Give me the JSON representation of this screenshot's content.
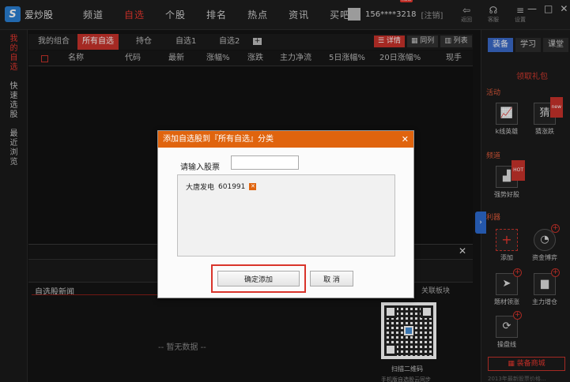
{
  "app": {
    "name": "爱炒股",
    "logo_glyph": "S"
  },
  "nav": [
    {
      "label": "频道",
      "active": false
    },
    {
      "label": "自选",
      "active": true
    },
    {
      "label": "个股",
      "active": false
    },
    {
      "label": "排名",
      "active": false
    },
    {
      "label": "热点",
      "active": false
    },
    {
      "label": "资讯",
      "active": false
    },
    {
      "label": "买吧",
      "active": false
    }
  ],
  "user": {
    "phone": "156****3218",
    "badge": "new",
    "logout": "[注销]"
  },
  "top_actions": [
    {
      "icon": "back-icon",
      "glyph": "⇦",
      "label": "返回"
    },
    {
      "icon": "service-icon",
      "glyph": "☊",
      "label": "客服"
    },
    {
      "icon": "settings-icon",
      "glyph": "≡",
      "label": "设置"
    }
  ],
  "window_controls": {
    "minimize": "—",
    "maximize": "□",
    "close": "✕"
  },
  "left_sidebar": [
    {
      "chars": [
        "我",
        "的",
        "自",
        "选"
      ],
      "active": true
    },
    {
      "chars": [
        "快",
        "速",
        "选",
        "股"
      ],
      "active": false
    },
    {
      "chars": [
        "最",
        "近",
        "浏",
        "览"
      ],
      "active": false
    }
  ],
  "tabs": [
    "我的组合",
    "所有自选",
    "持仓",
    "自选1",
    "自选2"
  ],
  "tab_add": "+",
  "view_buttons": [
    {
      "label": "☰ 详情",
      "active": true
    },
    {
      "label": "▦ 同列",
      "active": false
    },
    {
      "label": "▥ 列表",
      "active": false
    }
  ],
  "columns": [
    "名称",
    "代码",
    "最新",
    "涨幅%",
    "涨跌",
    "主力净流",
    "5日涨幅%",
    "20日涨幅%",
    "现手"
  ],
  "news": {
    "title": "自选股新闻",
    "related_tab": "关联板块",
    "empty_text": "-- 暂无数据 --"
  },
  "qr": {
    "caption": "扫描二维码",
    "caption2": "手机版自选股云同步"
  },
  "right_panel": {
    "tabs": [
      "装备",
      "学习",
      "课堂"
    ],
    "gift": "领取礼包",
    "sections": {
      "activity": "活动",
      "channel": "频道",
      "tools": "利器"
    },
    "activity_tools": [
      {
        "icon": "kline-chart-icon",
        "glyph": "📈",
        "label": "k线英雄"
      },
      {
        "icon": "guess-icon",
        "glyph": "猜",
        "label": "猜涨跌",
        "tag": "new"
      }
    ],
    "channel_tools": [
      {
        "icon": "bar-chart-icon",
        "glyph": "▟",
        "label": "强势好股",
        "tag": "HOT"
      }
    ],
    "tool_items": [
      {
        "icon": "add-icon",
        "glyph": "+",
        "label": "添加"
      },
      {
        "icon": "capital-icon",
        "glyph": "◔",
        "label": "资金博弈"
      },
      {
        "icon": "arrow-icon",
        "glyph": "➤",
        "label": "题材领涨"
      },
      {
        "icon": "histogram-icon",
        "glyph": "▆",
        "label": "主力增仓"
      },
      {
        "icon": "refresh-chart-icon",
        "glyph": "⟳",
        "label": "操盘线"
      }
    ],
    "mall": "▦ 装备商城",
    "footer": "2013年最新股票价格..."
  },
  "modal": {
    "title": "添加自选股到『所有自选』分类",
    "close": "✕",
    "input_label": "请输入股票",
    "input_value": "",
    "stocks": [
      {
        "name": "大唐发电",
        "code": "601991"
      }
    ],
    "delete_glyph": "✕",
    "confirm": "确定添加",
    "cancel": "取 消"
  },
  "colors": {
    "accent_red": "#c9332b",
    "modal_header": "#e0640e",
    "right_tab_blue": "#3a6ac8"
  }
}
